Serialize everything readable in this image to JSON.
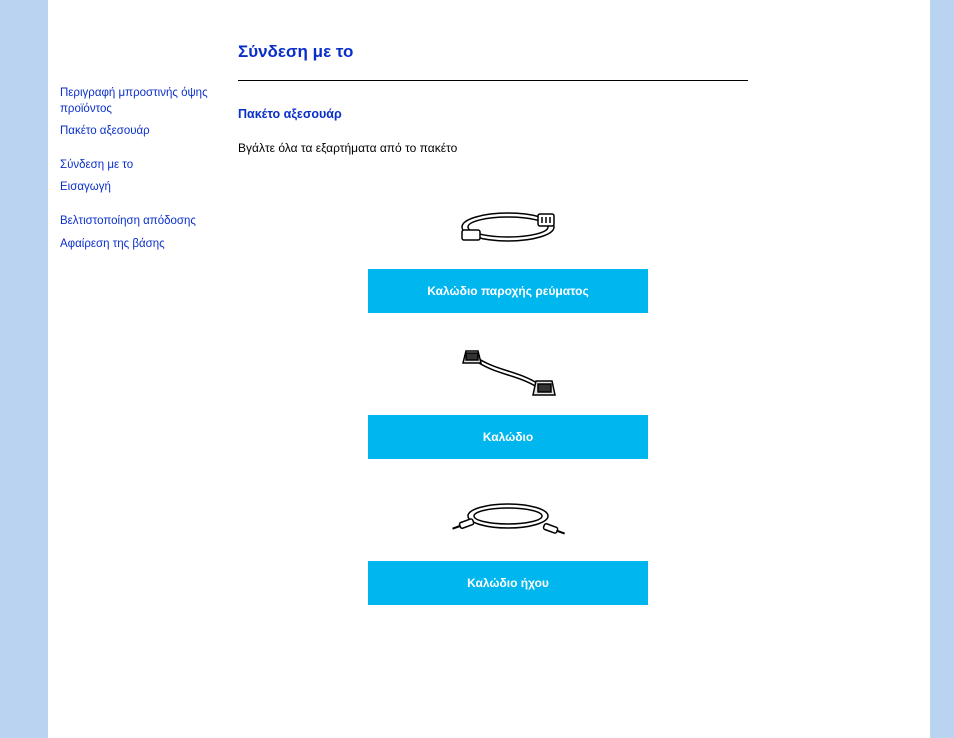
{
  "sidebar": {
    "links": [
      {
        "label": "Περιγραφή μπροστινής όψης προϊόντος"
      },
      {
        "label": "Πακέτο αξεσουάρ"
      },
      {
        "label": "Σύνδεση με το"
      },
      {
        "label": "Εισαγωγή"
      },
      {
        "label": "Βελτιστοποίηση απόδοσης"
      },
      {
        "label": "Αφαίρεση της βάσης"
      }
    ]
  },
  "main": {
    "title": "Σύνδεση με το",
    "section_heading": "Πακέτο αξεσουάρ",
    "instruction": "Βγάλτε όλα τα εξαρτήματα από το πακέτο",
    "accessories": [
      {
        "label": "Καλώδιο παροχής ρεύματος",
        "icon": "power-cable-icon"
      },
      {
        "label": "Καλώδιο",
        "icon": "vga-cable-icon"
      },
      {
        "label": "Καλώδιο ήχου",
        "icon": "audio-cable-icon"
      }
    ]
  },
  "colors": {
    "link": "#0a2fc9",
    "strip": "#b9d3f0",
    "label_bg": "#00b6ef"
  }
}
